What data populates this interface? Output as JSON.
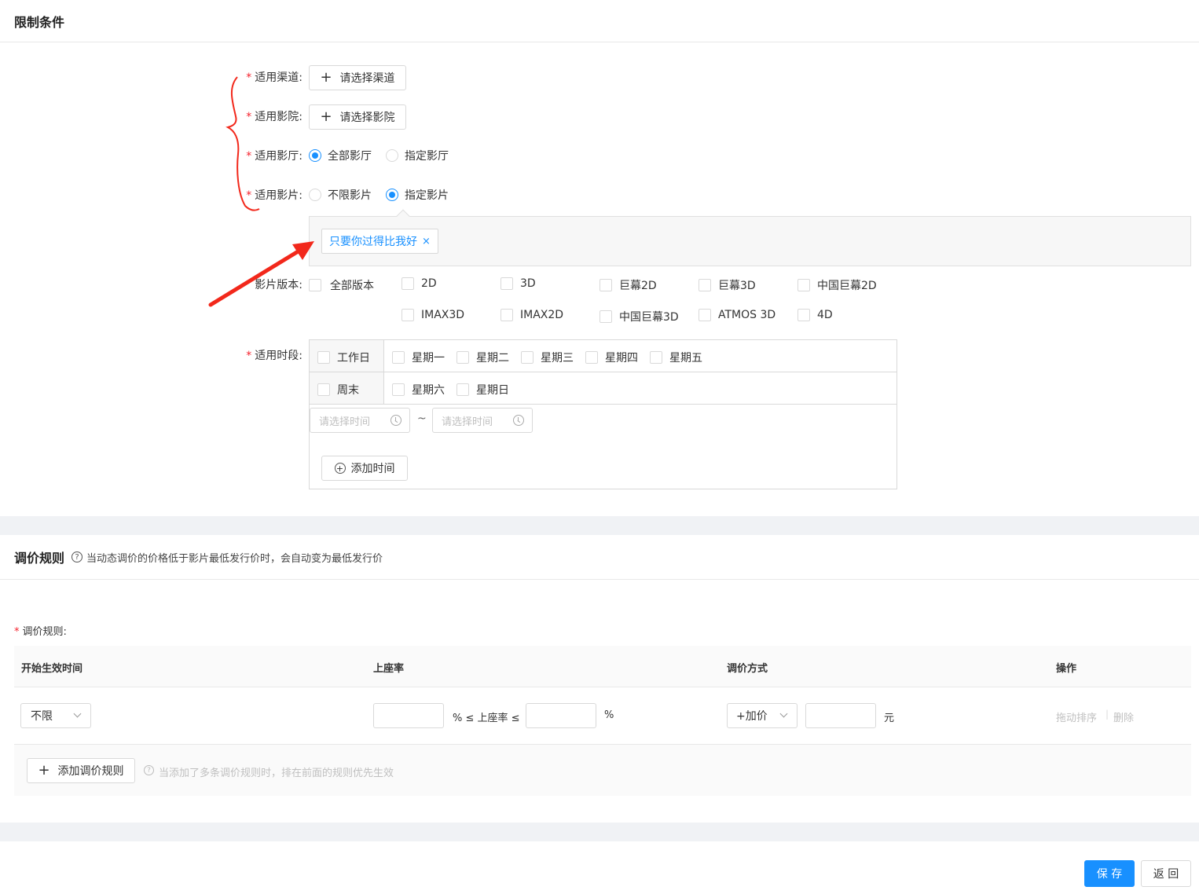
{
  "limits": {
    "title": "限制条件",
    "channel": {
      "label": "适用渠道:",
      "button": "请选择渠道"
    },
    "cinema": {
      "label": "适用影院:",
      "button": "请选择影院"
    },
    "hall": {
      "label": "适用影厅:",
      "options": [
        "全部影厅",
        "指定影厅"
      ],
      "selected": "全部影厅"
    },
    "film": {
      "label": "适用影片:",
      "options": [
        "不限影片",
        "指定影片"
      ],
      "selected": "指定影片"
    },
    "selected_films": [
      {
        "name": "只要你过得比我好",
        "close": "×"
      }
    ],
    "version": {
      "label": "影片版本:",
      "row1": [
        "全部版本",
        "2D",
        "3D",
        "巨幕2D",
        "巨幕3D",
        "中国巨幕2D"
      ],
      "row2": [
        "IMAX3D",
        "IMAX2D",
        "中国巨幕3D",
        "ATMOS 3D",
        "4D"
      ]
    },
    "period": {
      "label": "适用时段:",
      "workday": {
        "label": "工作日",
        "days": [
          "星期一",
          "星期二",
          "星期三",
          "星期四",
          "星期五"
        ]
      },
      "weekend": {
        "label": "周末",
        "days": [
          "星期六",
          "星期日"
        ]
      },
      "time_start_placeholder": "请选择时间",
      "time_end_placeholder": "请选择时间",
      "separator": "~",
      "add_time": "添加时间"
    }
  },
  "pricing": {
    "title": "调价规则",
    "tip": "当动态调价的价格低于影片最低发行价时，会自动变为最低发行价",
    "rule_label": "调价规则:",
    "columns": [
      "开始生效时间",
      "上座率",
      "调价方式",
      "操作"
    ],
    "row": {
      "start_time": "不限",
      "occupancy_mid": "% ≤ 上座率 ≤",
      "occupancy_unit": "%",
      "method": "+加价",
      "amount_unit": "元",
      "action_sort": "拖动排序",
      "action_sep": "|",
      "action_delete": "删除"
    },
    "add_button": "添加调价规则",
    "add_tip": "当添加了多条调价规则时，排在前面的规则优先生效"
  },
  "footer": {
    "save": "保 存",
    "back": "返 回"
  },
  "colors": {
    "primary": "#1890ff",
    "required": "#f5222d",
    "annotation": "#f2281b"
  }
}
